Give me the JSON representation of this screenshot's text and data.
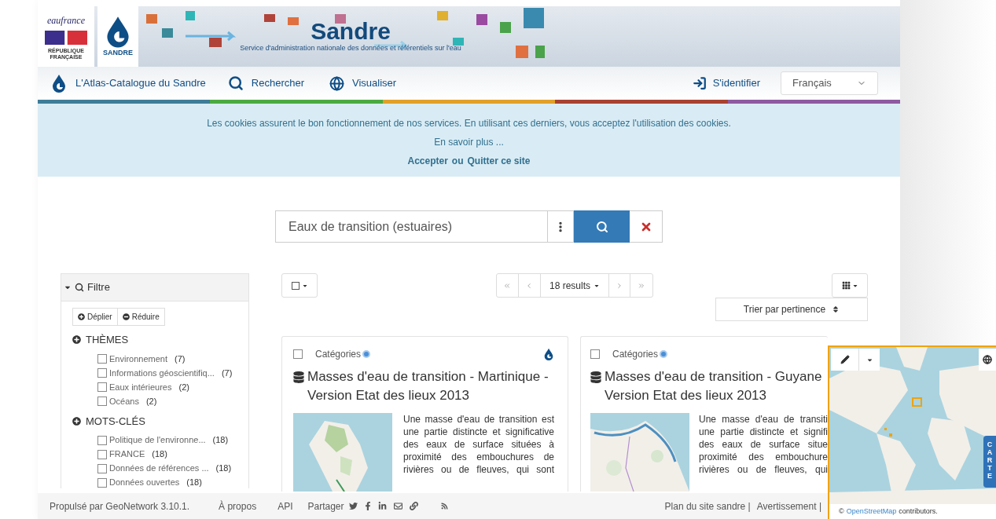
{
  "header": {
    "eaufrance": "eaufrance",
    "republic": "RÉPUBLIQUE FRANÇAISE",
    "sandre_logo": "SANDRE",
    "title": "Sandre",
    "subtitle": "Service d'administration nationale des données et référentiels sur l'eau"
  },
  "nav": {
    "items": [
      {
        "label": "L'Atlas-Catalogue du Sandre",
        "kind": "home"
      },
      {
        "label": "Rechercher",
        "kind": "search"
      },
      {
        "label": "Visualiser",
        "kind": "globe"
      }
    ],
    "login": "S'identifier",
    "language": "Français"
  },
  "color_bar": [
    {
      "color": "#3e7c98"
    },
    {
      "color": "#4aaa42"
    },
    {
      "color": "#e0a02a"
    },
    {
      "color": "#a84232"
    },
    {
      "color": "#8e5aa0"
    }
  ],
  "cookie": {
    "message": "Les cookies assurent le bon fonctionnement de nos services. En utilisant ces derniers, vous acceptez l'utilisation des cookies.",
    "more": "En savoir plus ...",
    "accept": "Accepter",
    "or": "ou",
    "quit": "Quitter ce site"
  },
  "search": {
    "value": "Eaux de transition (estuaires)"
  },
  "filter": {
    "title": "Filtre",
    "expanded": true,
    "expand_all": "Déplier",
    "collapse_all": "Réduire",
    "groups": [
      {
        "title": "THÈMES",
        "items": [
          {
            "label": "Environnement",
            "count": "(7)",
            "checked": false
          },
          {
            "label": "Informations géoscientifiq...",
            "count": "(7)",
            "checked": false
          },
          {
            "label": "Eaux intérieures",
            "count": "(2)",
            "checked": false
          },
          {
            "label": "Océans",
            "count": "(2)",
            "checked": false
          }
        ]
      },
      {
        "title": "MOTS-CLÉS",
        "items": [
          {
            "label": "Politique de l'environne...",
            "count": "(18)",
            "checked": false
          },
          {
            "label": "FRANCE",
            "count": "(18)",
            "checked": false
          },
          {
            "label": "Données de références ...",
            "count": "(18)",
            "checked": false
          },
          {
            "label": "Données ouvertes",
            "count": "(18)",
            "checked": false
          }
        ]
      }
    ]
  },
  "toolbar": {
    "results": "18 results",
    "sort": "Trier par pertinence"
  },
  "results": [
    {
      "category": "Catégories",
      "checked": false,
      "logo": true,
      "title_lines": [
        "Masses d'eau de transition - Martinique -",
        "Version Etat des lieux 2013"
      ],
      "description_lines": [
        "Une masse d'eau de transition est",
        "une partie distincte et significative",
        "des eaux de surface situées à",
        "proximité des embouchures de",
        "rivières ou de fleuves, qui sont"
      ]
    },
    {
      "category": "Catégories",
      "checked": false,
      "logo": false,
      "title_lines": [
        "Masses d'eau de transition - Guyane",
        "Version Etat des lieux 2013"
      ],
      "description_lines": [
        "Une masse d'eau de transiti",
        "une partie distincte et signifi",
        "des eaux de surface situe",
        "proximité des embouchure",
        "rivières ou de fleuves, qui"
      ]
    }
  ],
  "map": {
    "tab": "CARTE",
    "copyright": "©",
    "attribution_link": "OpenStreetMap",
    "attribution_text": "contributors."
  },
  "footer": {
    "powered": "Propulsé par GeoNetwork 3.10.1.",
    "links": [
      "À propos",
      "API"
    ],
    "share": "Partager",
    "right_links": [
      "Plan du site sandre |",
      "Avertissement |"
    ]
  }
}
